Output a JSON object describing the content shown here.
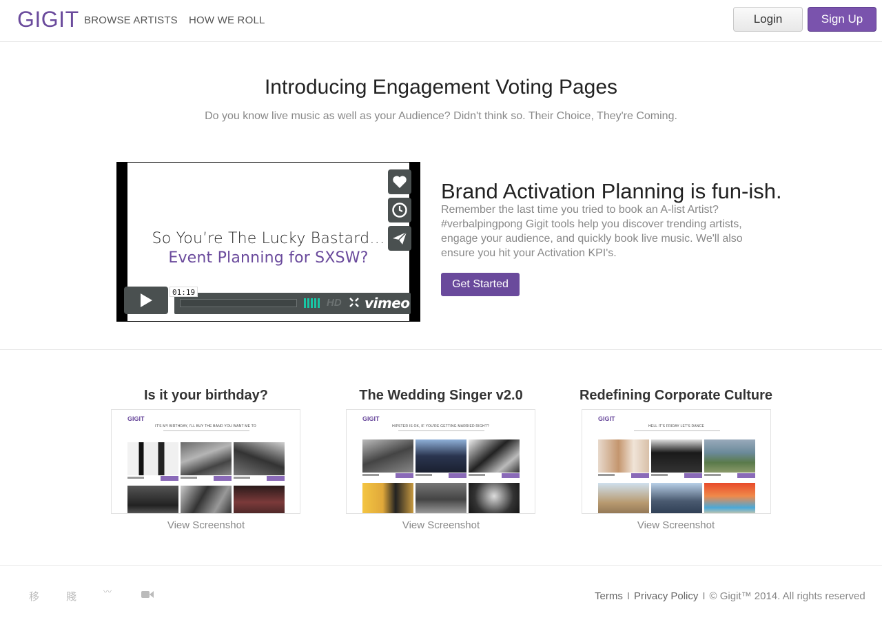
{
  "nav": {
    "brand": "GIGIT",
    "links": [
      "BROWSE ARTISTS",
      "HOW WE ROLL"
    ],
    "login": "Login",
    "signup": "Sign Up"
  },
  "hero": {
    "title": "Introducing Engagement Voting Pages",
    "subtitle": "Do you know live music as well as your Audience? Didn't think so. Their Choice, They're Coming."
  },
  "video": {
    "line1": "So You’re The Lucky Bastard…",
    "line2": "Event Planning for SXSW?",
    "time": "01:19",
    "hd_label": "HD",
    "player_brand": "vimeo",
    "side_icons": [
      "heart-icon",
      "clock-icon",
      "paper-plane-icon"
    ],
    "volume_level": 1.0,
    "progress": 0.0
  },
  "feature": {
    "title": "Brand Activation Planning is fun-ish.",
    "body": "Remember the last time you tried to book an A-list Artist? #verbalpingpong Gigit tools help you discover trending artists, engage your audience, and quickly book live music. We'll also ensure you hit your Activation KPI's.",
    "cta": "Get Started"
  },
  "cards": [
    {
      "title": "Is it your birthday?",
      "thumb_logo": "GIGIT",
      "thumb_heading": "IT'S MY BIRTHDAY, I'LL BUY THE BAND YOU WANT ME TO",
      "link": "View Screenshot"
    },
    {
      "title": "The Wedding Singer v2.0",
      "thumb_logo": "GIGIT",
      "thumb_heading": "HIPSTER IS OK, IF YOU'RE GETTING MARRIED RIGHT?",
      "link": "View Screenshot"
    },
    {
      "title": "Redefining Corporate Culture",
      "thumb_logo": "GIGIT",
      "thumb_heading": "HELL IT'S FRIDAY LET'S DANCE",
      "link": "View Screenshot"
    }
  ],
  "footer": {
    "social_icons": [
      "twitter-icon",
      "facebook-icon",
      "soundcloud-icon",
      "video-camera-icon"
    ],
    "social_glyphs": [
      "移",
      "賤",
      "〰",
      "■"
    ],
    "terms": "Terms",
    "privacy": "Privacy Policy",
    "separator": "I",
    "copyright": "© Gigit™ 2014. All rights reserved"
  },
  "colors": {
    "brand": "#6a4a9c",
    "accent_button": "#7a53ad",
    "player_gray": "#4a5050",
    "volume": "#18c6a5"
  }
}
